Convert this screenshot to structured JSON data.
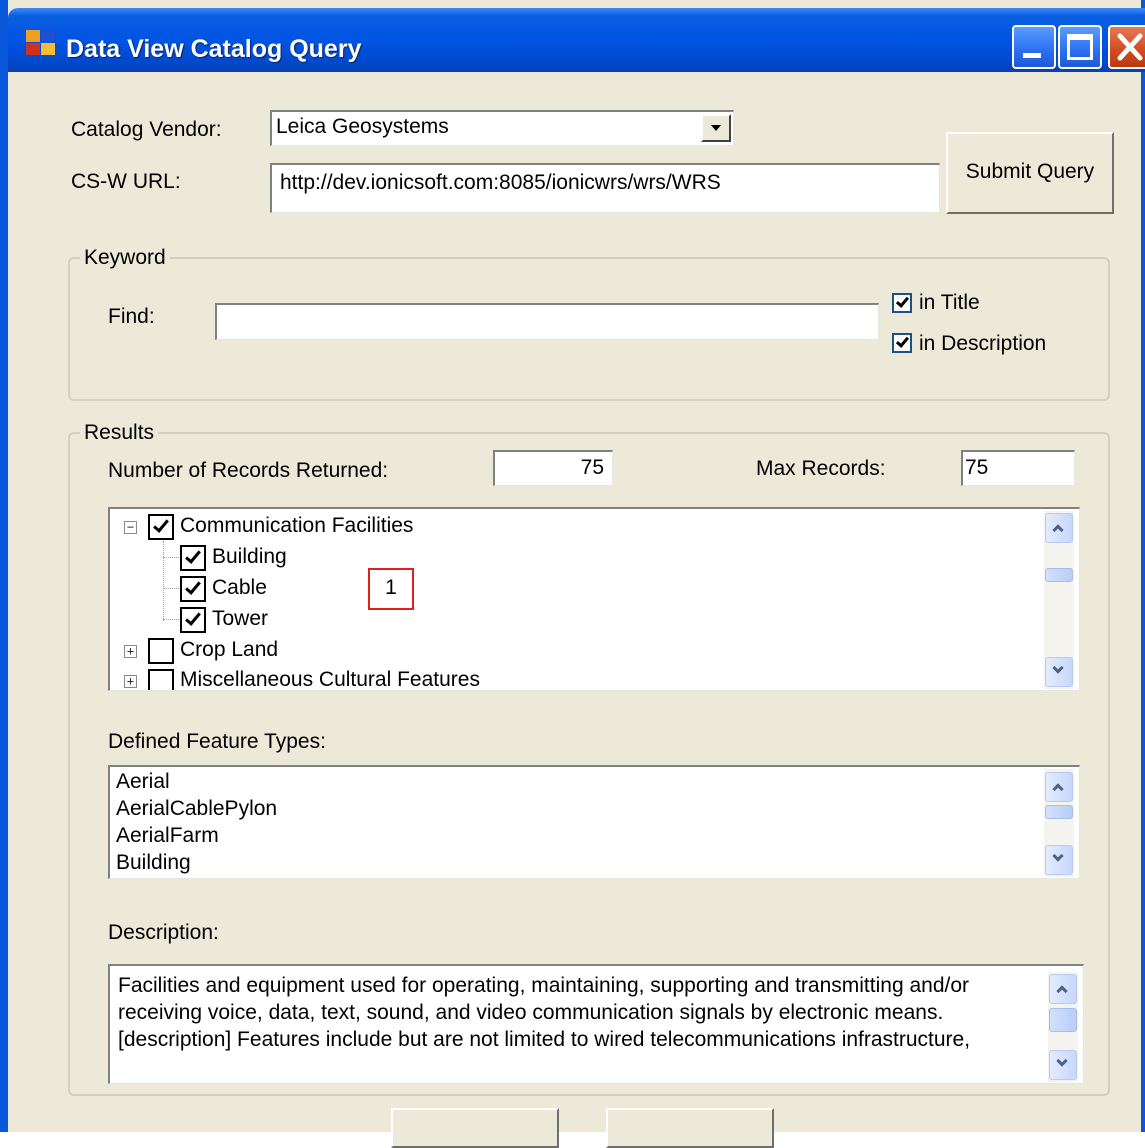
{
  "window": {
    "title": "Data View Catalog Query"
  },
  "top": {
    "vendor_label": "Catalog Vendor:",
    "vendor_value": "Leica Geosystems",
    "url_label": "CS-W  URL:",
    "url_value": "http://dev.ionicsoft.com:8085/ionicwrs/wrs/WRS",
    "submit_label": "Submit Query"
  },
  "keyword": {
    "group_title": "Keyword",
    "find_label": "Find:",
    "find_value": "",
    "in_title_label": "in Title",
    "in_title_checked": true,
    "in_description_label": "in Description",
    "in_description_checked": true
  },
  "results": {
    "group_title": "Results",
    "records_returned_label": "Number of Records Returned:",
    "records_returned_value": "75",
    "max_records_label": "Max Records:",
    "max_records_value": "75",
    "tree": [
      {
        "label": "Communication Facilities",
        "expanded": true,
        "checked": true,
        "children": [
          {
            "label": "Building",
            "checked": true
          },
          {
            "label": "Cable",
            "checked": true
          },
          {
            "label": "Tower",
            "checked": true
          }
        ]
      },
      {
        "label": "Crop Land",
        "expanded": false,
        "checked": false
      },
      {
        "label": "Miscellaneous Cultural Features",
        "expanded": false,
        "checked": false
      }
    ],
    "annotation_number": "1",
    "feature_types_label": "Defined Feature Types:",
    "feature_types": [
      "Aerial",
      "AerialCablePylon",
      "AerialFarm",
      "Building"
    ],
    "description_label": "Description:",
    "description_lines": [
      "Facilities and equipment used for operating, maintaining, supporting and transmitting and/or",
      "receiving voice, data, text, sound, and video communication signals by electronic means.",
      "[description] Features include but are not limited to wired telecommunications infrastructure,"
    ]
  },
  "colors": {
    "titlebar": "#0054e3",
    "window_bg": "#ece9d8",
    "annotation_border": "#e02020"
  }
}
